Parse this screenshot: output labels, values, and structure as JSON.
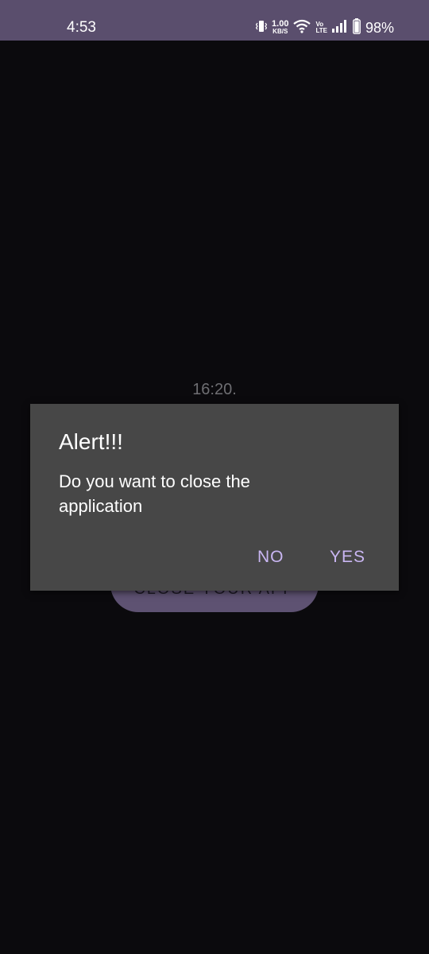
{
  "status_bar": {
    "time": "4:53",
    "speed_value": "1.00",
    "speed_unit": "KB/S",
    "volte_top": "Vo",
    "volte_bottom": "LTE",
    "battery_percent": "98%"
  },
  "app": {
    "time_label": "16:20.",
    "close_button_label": "CLOSE YOUR APP"
  },
  "dialog": {
    "title": "Alert!!!",
    "message": "Do you want to close the application",
    "negative_label": "NO",
    "positive_label": "YES",
    "accent_color": "#c9b6f2",
    "background_color": "#474747"
  },
  "colors": {
    "status_bar": "#5a4e6d",
    "background": "#0b0a0d",
    "button_bg": "#5e5272"
  }
}
